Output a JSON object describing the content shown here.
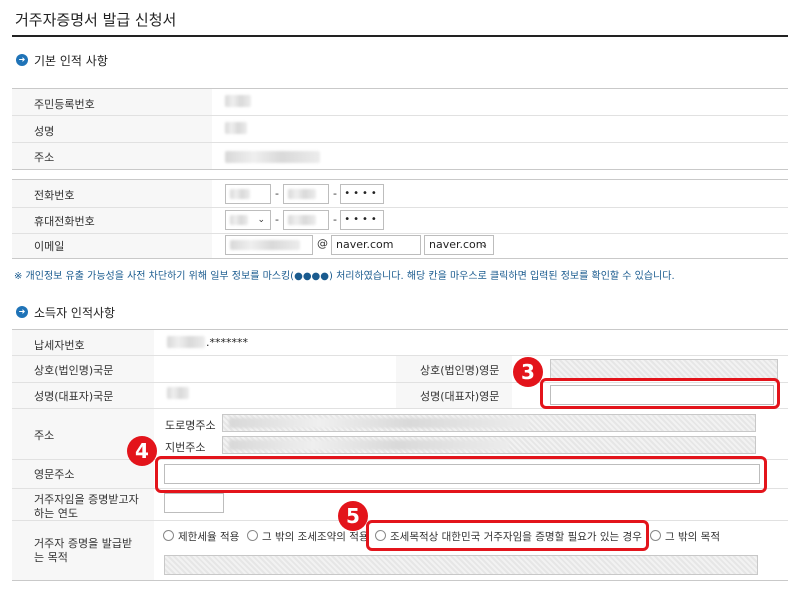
{
  "page": {
    "title": "거주자증명서 발급 신청서"
  },
  "section1": {
    "title": "기본 인적 사항",
    "labels": {
      "rrn": "주민등록번호",
      "name": "성명",
      "address": "주소",
      "phone": "전화번호",
      "mobile": "휴대전화번호",
      "email": "이메일"
    },
    "phone": {
      "dash1": "-",
      "dash2": "-",
      "masked": "••••"
    },
    "mobile": {
      "dash1": "-",
      "dash2": "-",
      "masked": "••••"
    },
    "email": {
      "at": "@",
      "domain_value": "naver.com",
      "domain_select": "naver.com"
    },
    "notice": "※ 개인정보 유출 가능성을 사전 차단하기 위해 일부 정보를 마스킹(●●●●) 처리하였습니다. 해당 칸을 마우스로 클릭하면 입력된 정보를 확인할 수 있습니다."
  },
  "section2": {
    "title": "소득자 인적사항",
    "labels": {
      "taxpayer_no": "납세자번호",
      "company_kr": "상호(법인명)국문",
      "company_en": "상호(법인명)영문",
      "rep_kr": "성명(대표자)국문",
      "rep_en": "성명(대표자)영문",
      "address": "주소",
      "road_address": "도로명주소",
      "lot_address": "지번주소",
      "en_address": "영문주소",
      "residence_year": "거주자임을 증명받고자 하는 연도",
      "purpose": "거주자 증명을 발급받는 목적"
    },
    "taxpayer_masked": ".*******",
    "purpose_options": [
      "제한세율 적용",
      "그 밖의 조세조약의 적용",
      "조세목적상 대한민국 거주자임을 증명할 필요가 있는 경우",
      "그 밖의 목적"
    ]
  },
  "annotations": {
    "badge3": "3",
    "badge4": "4",
    "badge5": "5",
    "color": "#e3141b"
  }
}
